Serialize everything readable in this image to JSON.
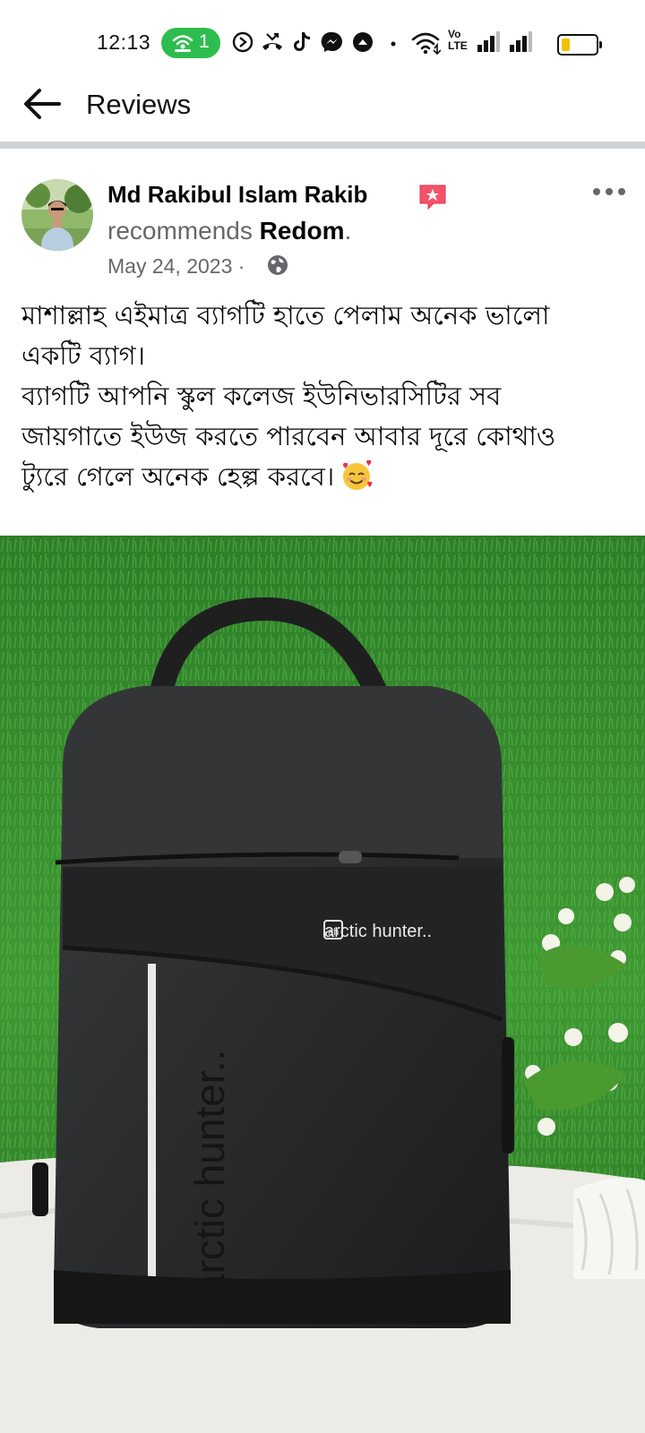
{
  "status_bar": {
    "time": "12:13",
    "hotspot_count": "1",
    "icons": [
      "hotspot-icon",
      "clock-icon",
      "missed-call-icon",
      "tiktok-icon",
      "messenger-icon",
      "circle-up-icon",
      "dot-icon",
      "wifi-icon",
      "volte-icon",
      "signal-icon",
      "signal-icon",
      "battery-icon"
    ],
    "volte_label": [
      "Vo",
      "LTE"
    ],
    "battery_color": "#f2c200",
    "hotspot_color": "#2dbd4e"
  },
  "header": {
    "title": "Reviews"
  },
  "post": {
    "author": "Md Rakibul Islam Rakib",
    "recommends_prefix": "recommends",
    "page_name": "Redom",
    "page_suffix": ".",
    "date": "May 24, 2023",
    "separator": "·",
    "text_lines": [
      "মাশাল্লাহ এইমাত্র ব্যাগটি হাতে পেলাম অনেক ভালো",
      "একটি ব্যাগ।",
      "ব্যাগটি আপনি স্কুল কলেজ ইউনিভারসিটির সব",
      "জায়গাতে ইউজ করতে পারবেন আবার দূরে কোথাও",
      "ট্যুরে গেলে অনেক হেল্প করবে।"
    ],
    "emoji": "smiling-face-with-hearts-icon",
    "badge_icon": "top-fan-badge-icon",
    "badge_color": "#f35369"
  },
  "photo": {
    "brand_logo_text": "arctic hunter..",
    "brand_side_text": "arctic hunter..",
    "logo_mark": "ah"
  }
}
